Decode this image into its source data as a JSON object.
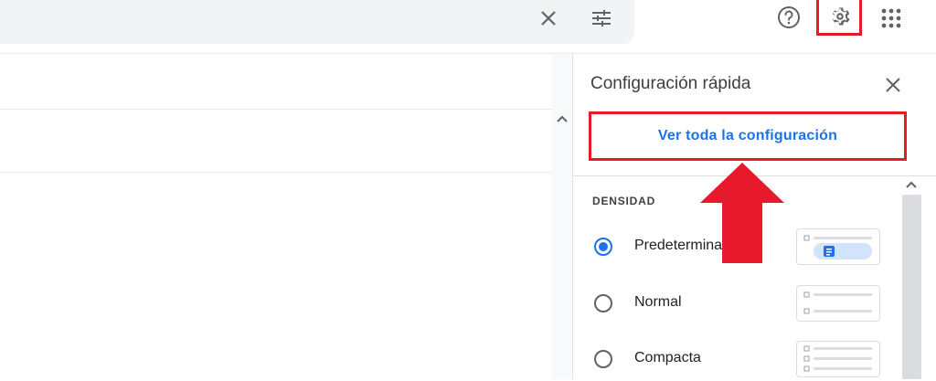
{
  "panel": {
    "title": "Configuración rápida",
    "all_settings": "Ver toda la configuración",
    "density_label": "DENSIDAD",
    "options": [
      {
        "label": "Predeterminada",
        "selected": true
      },
      {
        "label": "Normal",
        "selected": false
      },
      {
        "label": "Compacta",
        "selected": false
      }
    ]
  },
  "colors": {
    "accent": "#1a73e8",
    "highlight": "#e8192c",
    "icon": "#5f6368"
  },
  "icons": {
    "clear": "close-icon",
    "filter": "tune-icon",
    "help": "help-icon",
    "settings": "gear-icon",
    "apps": "apps-grid-icon"
  }
}
